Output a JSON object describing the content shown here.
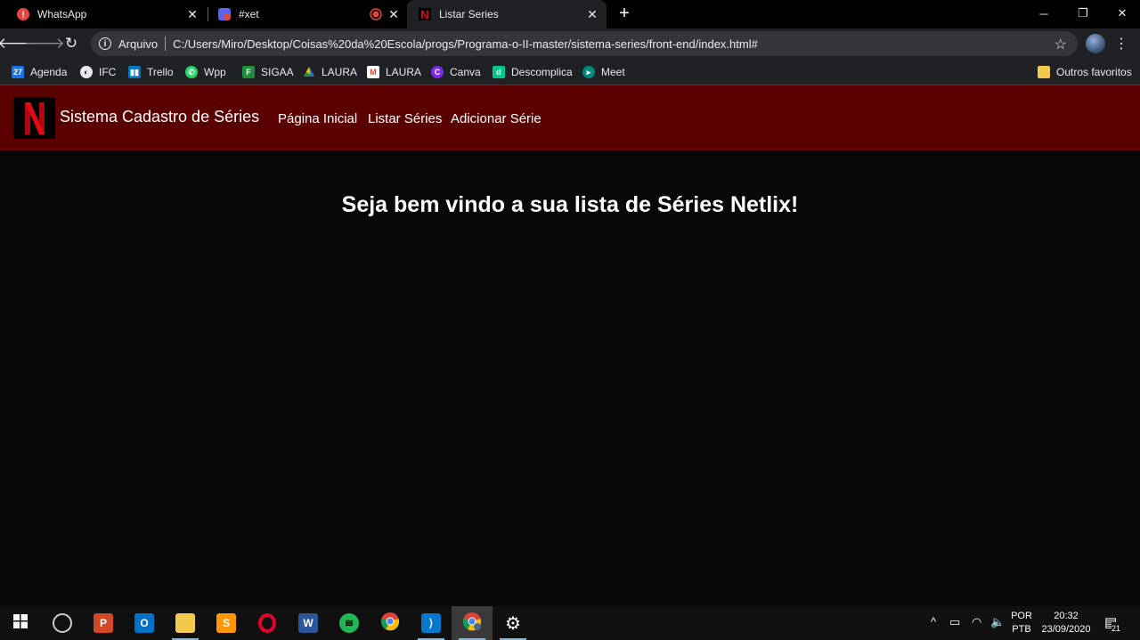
{
  "browser": {
    "tabs": [
      {
        "title": "WhatsApp",
        "favicon": "whatsapp-icon"
      },
      {
        "title": "#xet",
        "favicon": "discord-icon"
      },
      {
        "title": "",
        "favicon": "recording-icon"
      },
      {
        "title": "Listar Series",
        "favicon": "netflix-icon"
      }
    ],
    "omnibox": {
      "scheme_label": "Arquivo",
      "url": "C:/Users/Miro/Desktop/Coisas%20da%20Escola/progs/Programa-o-II-master/sistema-series/front-end/index.html#"
    },
    "bookmarks": [
      {
        "label": "Agenda",
        "icon": "calendar-icon",
        "color": "#1a73e8"
      },
      {
        "label": "IFC",
        "icon": "globe-icon",
        "color": "#e8eaed"
      },
      {
        "label": "Trello",
        "icon": "trello-icon",
        "color": "#0079bf"
      },
      {
        "label": "Wpp",
        "icon": "whatsapp-icon",
        "color": "#25d366"
      },
      {
        "label": "SIGAA",
        "icon": "sigaa-icon",
        "color": "#1e8e3e"
      },
      {
        "label": "LAURA",
        "icon": "google-drive-icon",
        "color": "#fbbc04"
      },
      {
        "label": "LAURA",
        "icon": "gmail-icon",
        "color": "#ea4335"
      },
      {
        "label": "Canva",
        "icon": "canva-icon",
        "color": "#7d2ae8"
      },
      {
        "label": "Descomplica",
        "icon": "descomplica-icon",
        "color": "#00c88c"
      },
      {
        "label": "Meet",
        "icon": "meet-icon",
        "color": "#00897b"
      }
    ],
    "other_bookmarks": "Outros favoritos"
  },
  "site": {
    "brand": "Sistema Cadastro de Séries",
    "nav": [
      "Página Inicial",
      "Listar Séries",
      "Adicionar Série"
    ],
    "welcome": "Seja bem vindo a sua lista de Séries Netlix!",
    "colors": {
      "navbar": "#5a0000",
      "background": "#080808",
      "logo_red": "#e50914"
    }
  },
  "taskbar": {
    "apps": [
      "start-icon",
      "headset-icon",
      "powerpoint-icon",
      "outlook-icon",
      "file-explorer-icon",
      "sublime-icon",
      "opera-icon",
      "word-icon",
      "spotify-icon",
      "chrome-icon",
      "vscode-icon",
      "chrome-profile-icon",
      "settings-icon"
    ],
    "language": "POR",
    "keyboard": "PTB",
    "time": "20:32",
    "date": "23/09/2020",
    "notifications": "21"
  }
}
